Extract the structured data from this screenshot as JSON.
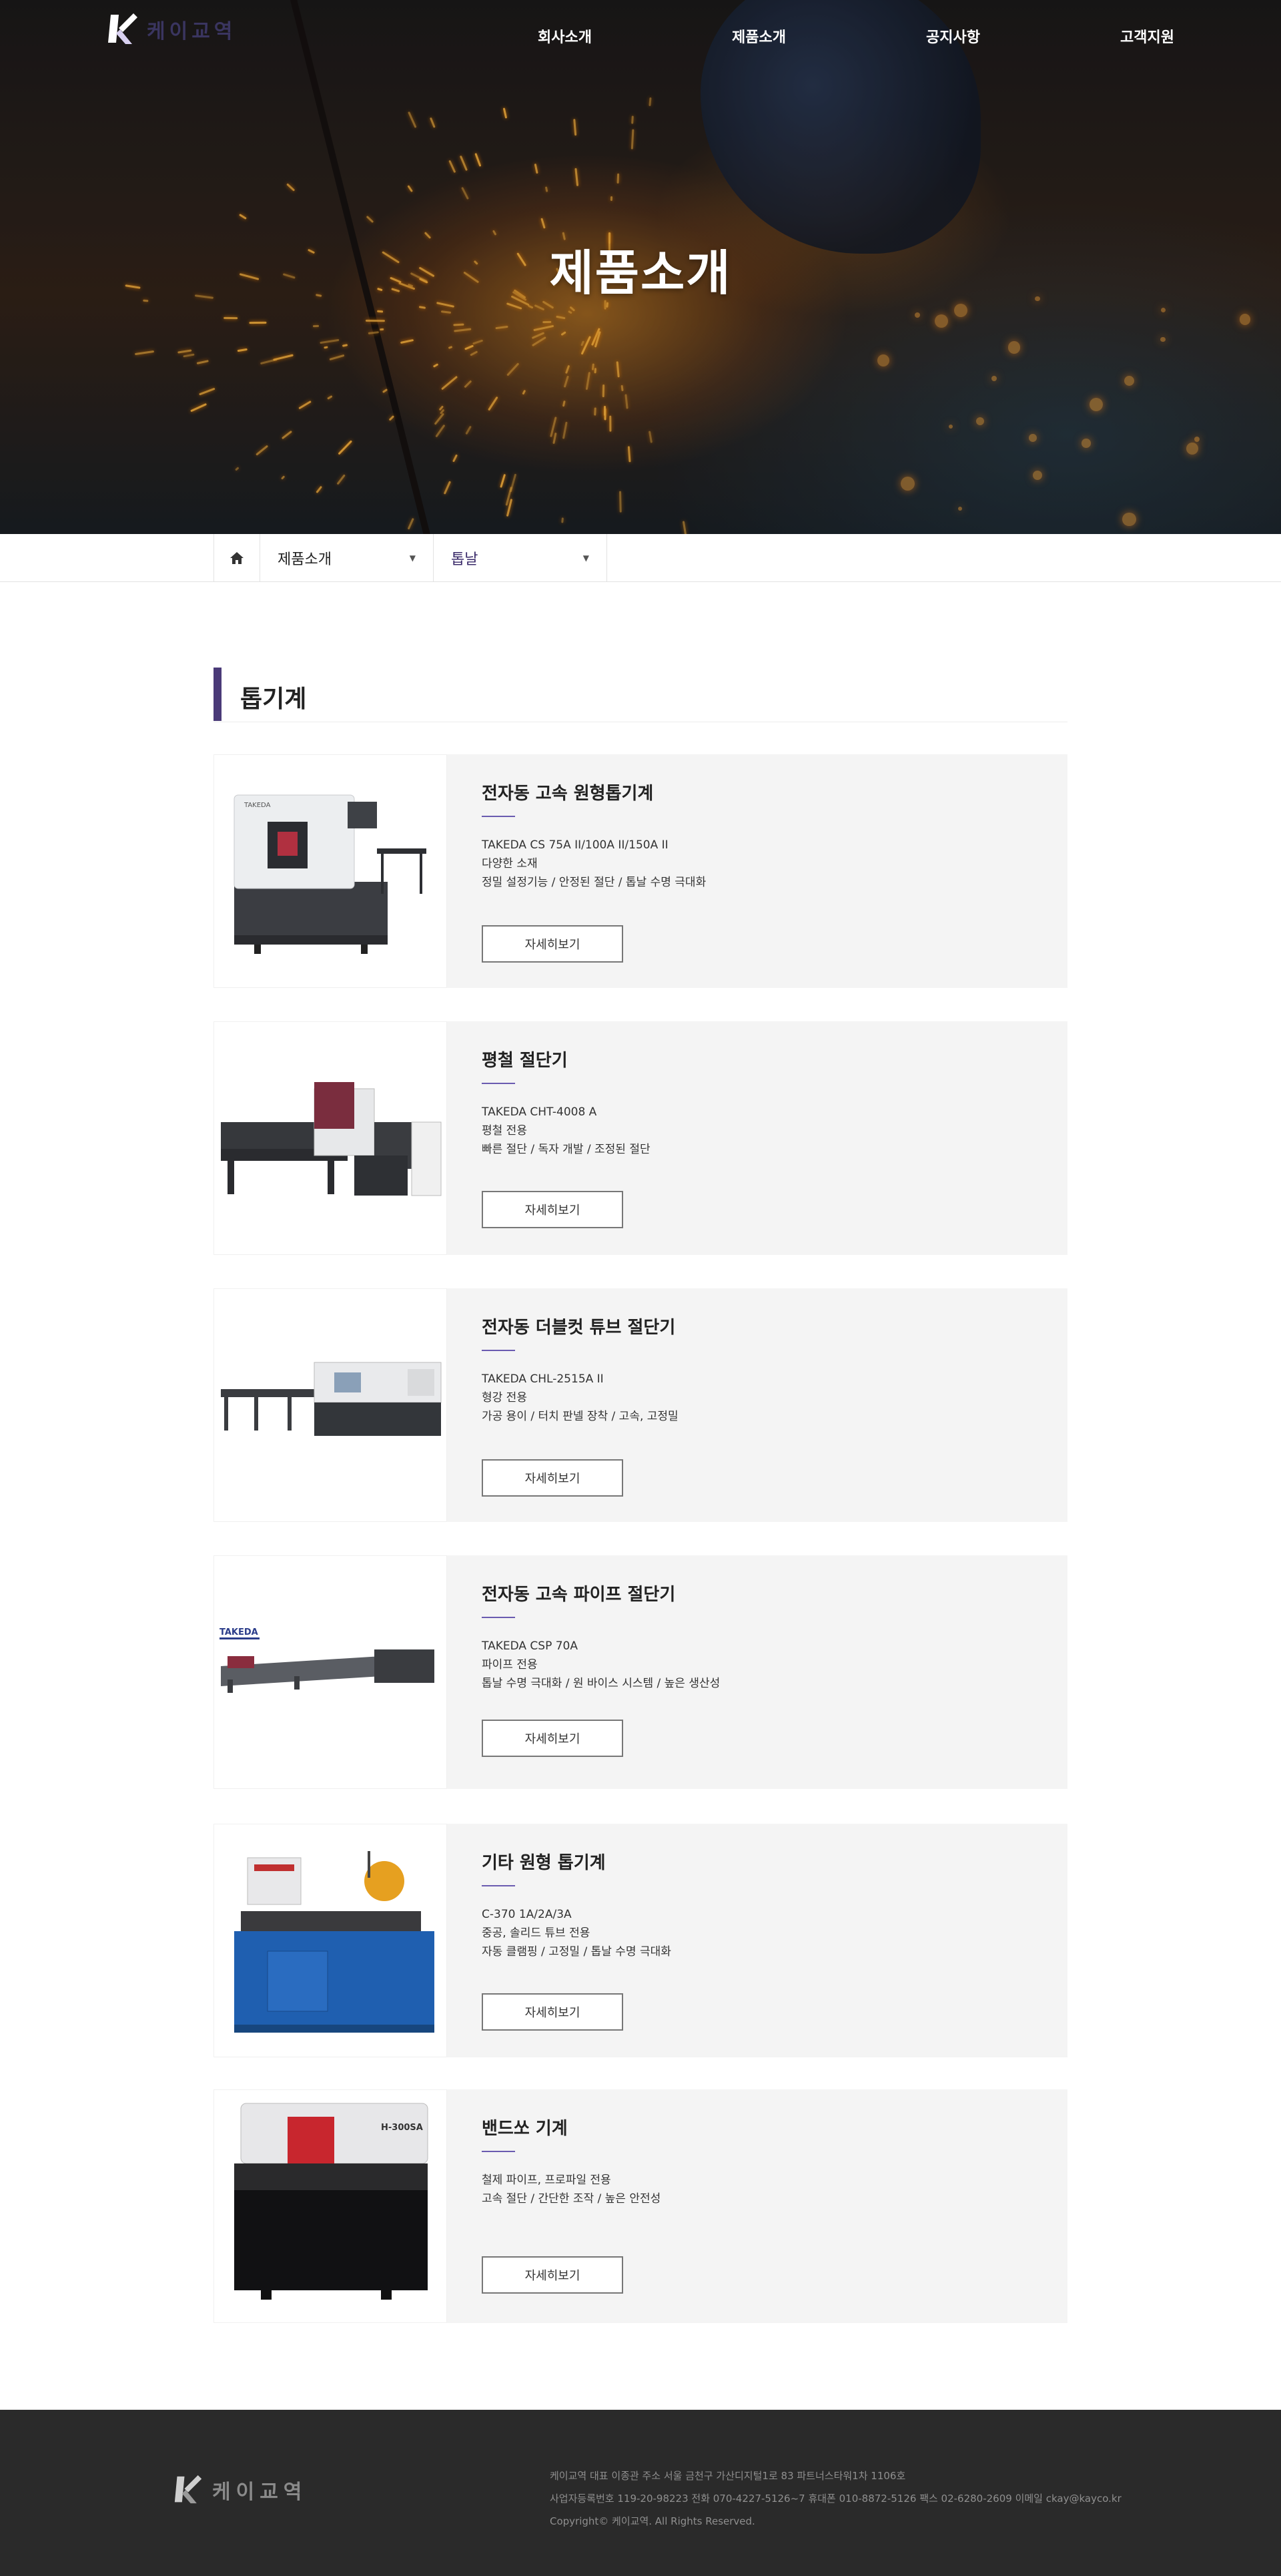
{
  "brand": {
    "name": "케이교역",
    "footer_name": "케이교역"
  },
  "nav": [
    {
      "label": "회사소개"
    },
    {
      "label": "제품소개"
    },
    {
      "label": "공지사항"
    },
    {
      "label": "고객지원"
    }
  ],
  "hero": {
    "title": "제품소개"
  },
  "subnav": {
    "home_icon": "home-icon",
    "menu1": "제품소개",
    "menu2": "톱날"
  },
  "section": {
    "title": "톱기계"
  },
  "products": [
    {
      "title": "전자동 고속 원형톱기계",
      "lines": [
        "TAKEDA CS 75A II/100A II/150A II",
        "다양한 소재",
        "정밀 설정기능 / 안정된 절단 / 톱날 수명 극대화"
      ],
      "button": "자세히보기"
    },
    {
      "title": "평철 절단기",
      "lines": [
        "TAKEDA CHT-4008 A",
        "평철 전용",
        "빠른 절단 / 독자 개발 / 조정된 절단"
      ],
      "button": "자세히보기"
    },
    {
      "title": "전자동 더블컷 튜브 절단기",
      "lines": [
        "TAKEDA CHL-2515A II",
        "형강 전용",
        "가공 용이 / 터치 판넬 장착 / 고속, 고정밀"
      ],
      "button": "자세히보기"
    },
    {
      "title": "전자동 고속 파이프 절단기",
      "lines": [
        "TAKEDA CSP 70A",
        "파이프 전용",
        "톱날 수명 극대화 / 원 바이스 시스템 / 높은 생산성"
      ],
      "button": "자세히보기"
    },
    {
      "title": "기타 원형 톱기계",
      "lines": [
        "C-370 1A/2A/3A",
        "중공, 솔리드 튜브 전용",
        "자동 클램핑 / 고정밀 / 톱날 수명 극대화"
      ],
      "button": "자세히보기"
    },
    {
      "title": "밴드쏘 기계",
      "lines": [
        "철제 파이프, 프로파일 전용",
        "고속 절단 / 간단한 조작 / 높은 안전성"
      ],
      "button": "자세히보기"
    }
  ],
  "machine_labels": {
    "takeda": "TAKEDA",
    "h300": "H-300SA"
  },
  "footer": {
    "line1": "케이교역   대표 이종관   주소 서울 금천구 가산디지털1로 83 파트너스타워1차 1106호",
    "line2": "사업자등록번호 119-20-98223    전화 070-4227-5126~7    휴대폰 010-8872-5126    팩스 02-6280-2609    이메일 ckay@kayco.kr",
    "line3": "Copyright© 케이교역. All Rights Reserved."
  },
  "colors": {
    "accent": "#4a3a78",
    "rule": "#6a5bb0",
    "footer_bg": "#2a2a2a"
  }
}
